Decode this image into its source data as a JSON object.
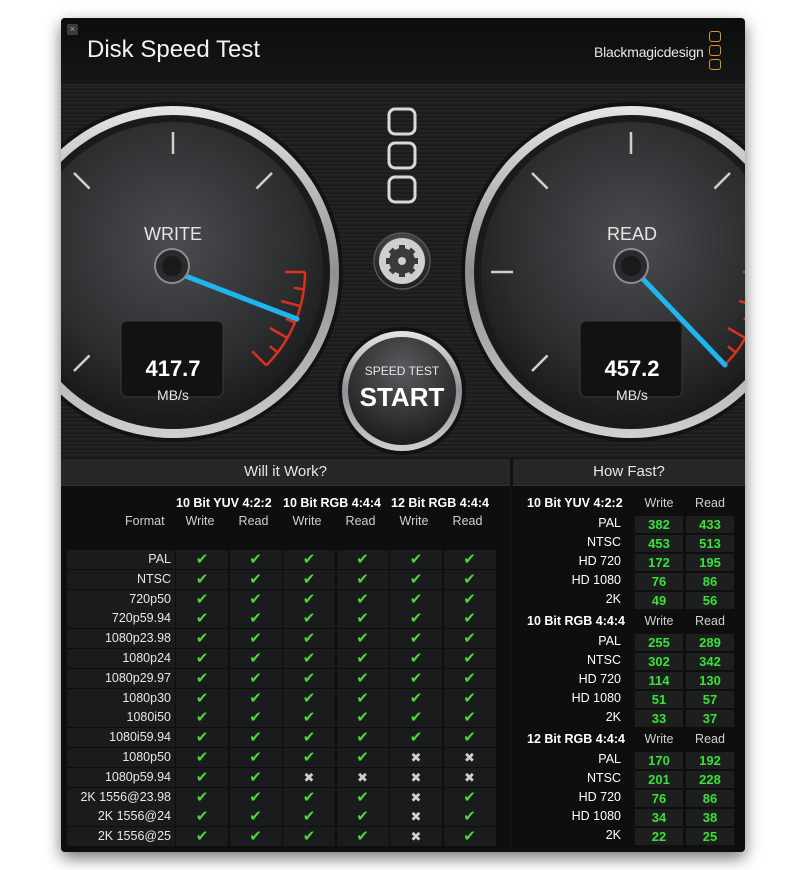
{
  "title": "Disk Speed Test",
  "brand": "Blackmagicdesign",
  "close": "×",
  "gauges": {
    "write": {
      "label": "WRITE",
      "value": "417.7",
      "unit": "MB/s"
    },
    "read": {
      "label": "READ",
      "value": "457.2",
      "unit": "MB/s"
    }
  },
  "start_button": {
    "line1": "SPEED TEST",
    "line2": "START"
  },
  "will_it_work": {
    "heading": "Will it Work?",
    "format_label": "Format",
    "groups": [
      "10 Bit YUV 4:2:2",
      "10 Bit RGB 4:4:4",
      "12 Bit RGB 4:4:4"
    ],
    "subcols": [
      "Write",
      "Read",
      "Write",
      "Read",
      "Write",
      "Read"
    ],
    "rows": [
      {
        "fmt": "PAL",
        "v": [
          1,
          1,
          1,
          1,
          1,
          1
        ]
      },
      {
        "fmt": "NTSC",
        "v": [
          1,
          1,
          1,
          1,
          1,
          1
        ]
      },
      {
        "fmt": "720p50",
        "v": [
          1,
          1,
          1,
          1,
          1,
          1
        ]
      },
      {
        "fmt": "720p59.94",
        "v": [
          1,
          1,
          1,
          1,
          1,
          1
        ]
      },
      {
        "fmt": "1080p23.98",
        "v": [
          1,
          1,
          1,
          1,
          1,
          1
        ]
      },
      {
        "fmt": "1080p24",
        "v": [
          1,
          1,
          1,
          1,
          1,
          1
        ]
      },
      {
        "fmt": "1080p29.97",
        "v": [
          1,
          1,
          1,
          1,
          1,
          1
        ]
      },
      {
        "fmt": "1080p30",
        "v": [
          1,
          1,
          1,
          1,
          1,
          1
        ]
      },
      {
        "fmt": "1080i50",
        "v": [
          1,
          1,
          1,
          1,
          1,
          1
        ]
      },
      {
        "fmt": "1080i59.94",
        "v": [
          1,
          1,
          1,
          1,
          1,
          1
        ]
      },
      {
        "fmt": "1080p50",
        "v": [
          1,
          1,
          1,
          1,
          0,
          0
        ]
      },
      {
        "fmt": "1080p59.94",
        "v": [
          1,
          1,
          0,
          0,
          0,
          0
        ]
      },
      {
        "fmt": "2K 1556@23.98",
        "v": [
          1,
          1,
          1,
          1,
          0,
          1
        ]
      },
      {
        "fmt": "2K 1556@24",
        "v": [
          1,
          1,
          1,
          1,
          0,
          1
        ]
      },
      {
        "fmt": "2K 1556@25",
        "v": [
          1,
          1,
          1,
          1,
          0,
          1
        ]
      }
    ],
    "glyph_ok": "✔",
    "glyph_no": "✖"
  },
  "how_fast": {
    "heading": "How Fast?",
    "col_write": "Write",
    "col_read": "Read",
    "groups": [
      {
        "name": "10 Bit YUV 4:2:2",
        "rows": [
          {
            "fmt": "PAL",
            "write": "382",
            "read": "433"
          },
          {
            "fmt": "NTSC",
            "write": "453",
            "read": "513"
          },
          {
            "fmt": "HD 720",
            "write": "172",
            "read": "195"
          },
          {
            "fmt": "HD 1080",
            "write": "76",
            "read": "86"
          },
          {
            "fmt": "2K",
            "write": "49",
            "read": "56"
          }
        ]
      },
      {
        "name": "10 Bit RGB 4:4:4",
        "rows": [
          {
            "fmt": "PAL",
            "write": "255",
            "read": "289"
          },
          {
            "fmt": "NTSC",
            "write": "302",
            "read": "342"
          },
          {
            "fmt": "HD 720",
            "write": "114",
            "read": "130"
          },
          {
            "fmt": "HD 1080",
            "write": "51",
            "read": "57"
          },
          {
            "fmt": "2K",
            "write": "33",
            "read": "37"
          }
        ]
      },
      {
        "name": "12 Bit RGB 4:4:4",
        "rows": [
          {
            "fmt": "PAL",
            "write": "170",
            "read": "192"
          },
          {
            "fmt": "NTSC",
            "write": "201",
            "read": "228"
          },
          {
            "fmt": "HD 720",
            "write": "76",
            "read": "86"
          },
          {
            "fmt": "HD 1080",
            "write": "34",
            "read": "38"
          },
          {
            "fmt": "2K",
            "write": "22",
            "read": "25"
          }
        ]
      }
    ]
  },
  "colors": {
    "accent": "#1fb6ef",
    "check": "#4fd63a",
    "value": "#39e13a",
    "logo": "#e39427",
    "redline": "#d8321f"
  }
}
